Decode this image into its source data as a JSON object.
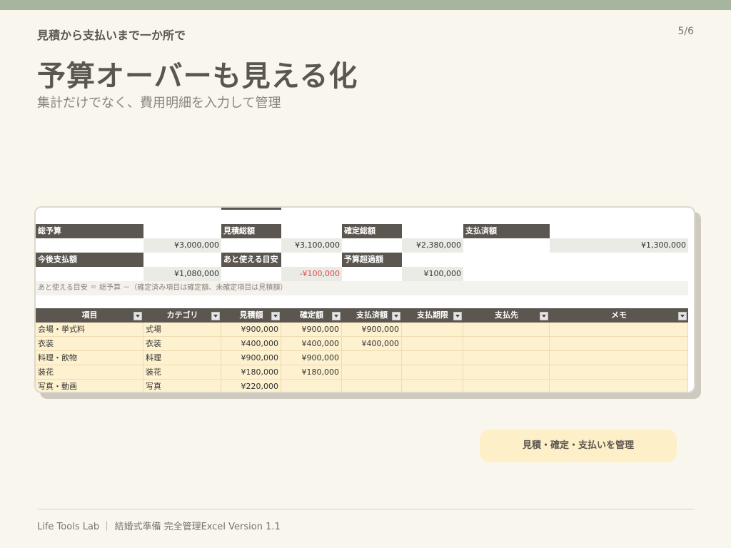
{
  "header": {
    "kicker": "見積から支払いまで一か所で",
    "page_number": "5/6",
    "title": "予算オーバーも見える化",
    "subtitle": "集計だけでなく、費用明細を入力して管理"
  },
  "summary": {
    "total_budget_label": "総予算",
    "total_budget_value": "¥3,000,000",
    "estimate_total_label": "見積総額",
    "estimate_total_value": "¥3,100,000",
    "confirmed_total_label": "確定総額",
    "confirmed_total_value": "¥2,380,000",
    "paid_total_label": "支払済額",
    "paid_total_value": "¥1,300,000",
    "remaining_payment_label": "今後支払額",
    "remaining_payment_value": "¥1,080,000",
    "available_label": "あと使える目安",
    "available_value": "-¥100,000",
    "over_budget_label": "予算超過額",
    "over_budget_value": "¥100,000",
    "note": "あと使える目安 ＝ 総予算 －（確定済み項目は確定額、未確定項目は見積額）"
  },
  "table": {
    "columns": [
      "項目",
      "カテゴリ",
      "見積額",
      "確定額",
      "支払済額",
      "支払期限",
      "支払先",
      "メモ"
    ],
    "rows": [
      [
        "会場・挙式料",
        "式場",
        "¥900,000",
        "¥900,000",
        "¥900,000",
        "",
        "",
        ""
      ],
      [
        "衣装",
        "衣装",
        "¥400,000",
        "¥400,000",
        "¥400,000",
        "",
        "",
        ""
      ],
      [
        "料理・飲物",
        "料理",
        "¥900,000",
        "¥900,000",
        "",
        "",
        "",
        ""
      ],
      [
        "装花",
        "装花",
        "¥180,000",
        "¥180,000",
        "",
        "",
        "",
        ""
      ],
      [
        "写真・動画",
        "写真",
        "¥220,000",
        "",
        "",
        "",
        "",
        ""
      ]
    ]
  },
  "cta": {
    "label": "見積・確定・支払いを管理"
  },
  "footer": {
    "text": "Life Tools Lab ｜ 結婚式準備 完全管理Excel  Version 1.1"
  },
  "colors": {
    "accent_bar": "#a8b59e",
    "header_fill": "#5c5650",
    "data_fill": "#fdf1cf",
    "negative": "#e04848",
    "cta_fill": "#fdf0c8"
  }
}
